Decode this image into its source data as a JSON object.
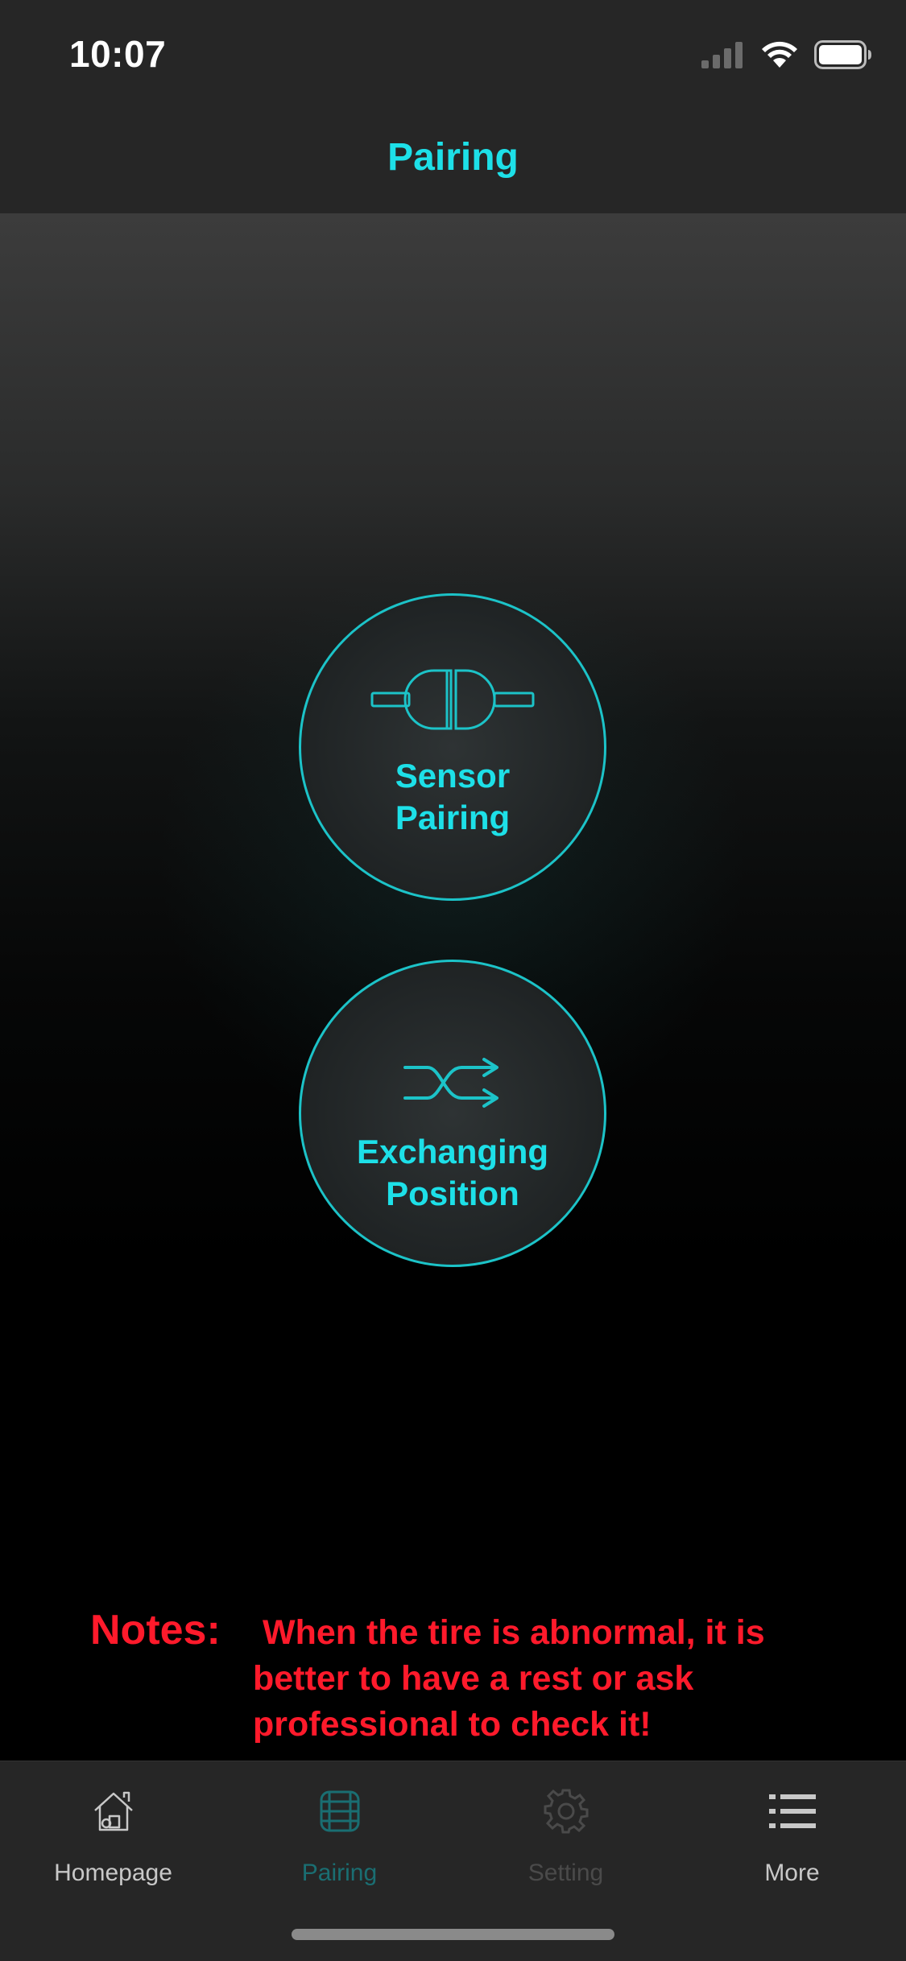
{
  "status_bar": {
    "time": "10:07",
    "icons": [
      "signal-icon",
      "wifi-icon",
      "battery-icon"
    ]
  },
  "header": {
    "title": "Pairing"
  },
  "actions": [
    {
      "id": "sensor-pairing",
      "icon": "plug-connector-icon",
      "line1": "Sensor",
      "line2": "Pairing"
    },
    {
      "id": "exchanging-position",
      "icon": "shuffle-arrows-icon",
      "line1": "Exchanging",
      "line2": "Position"
    }
  ],
  "notes": {
    "label": "Notes:",
    "text": "When the tire is abnormal, it is better to have a rest or ask professional to check it!"
  },
  "tabbar": {
    "tabs": [
      {
        "label": "Homepage",
        "icon": "home-icon",
        "state": "normal"
      },
      {
        "label": "Pairing",
        "icon": "tire-icon",
        "state": "selected"
      },
      {
        "label": "Setting",
        "icon": "gear-icon",
        "state": "disabled"
      },
      {
        "label": "More",
        "icon": "list-icon",
        "state": "normal"
      }
    ]
  },
  "colors": {
    "accent": "#1de0e8",
    "accent_dim": "#1a6e72",
    "notes_red": "#ff1a2b",
    "bar_bg": "#262626",
    "tab_normal": "#c8c8c8",
    "tab_disabled": "#4a4a4a"
  }
}
